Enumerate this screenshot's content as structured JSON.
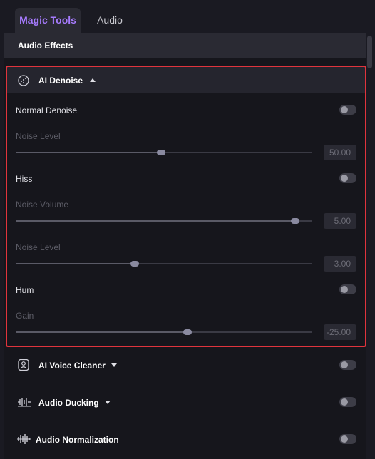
{
  "tabs": [
    {
      "label": "Magic Tools",
      "active": true
    },
    {
      "label": "Audio",
      "active": false
    }
  ],
  "section": {
    "title": "Audio Effects"
  },
  "denoise": {
    "title": "AI Denoise",
    "normal_denoise": {
      "label": "Normal Denoise",
      "enabled": false
    },
    "noise_level_1": {
      "label": "Noise Level",
      "value": "50.00",
      "fraction": 0.49
    },
    "hiss": {
      "label": "Hiss",
      "enabled": false
    },
    "noise_volume": {
      "label": "Noise Volume",
      "value": "5.00",
      "fraction": 0.942
    },
    "noise_level_2": {
      "label": "Noise Level",
      "value": "3.00",
      "fraction": 0.401
    },
    "hum": {
      "label": "Hum",
      "enabled": false
    },
    "gain": {
      "label": "Gain",
      "value": "-25.00",
      "fraction": 0.579
    }
  },
  "features": [
    {
      "label": "AI Voice Cleaner",
      "icon": "voice-cleaner-icon",
      "enabled": false
    },
    {
      "label": "Audio Ducking",
      "icon": "audio-ducking-icon",
      "enabled": false
    },
    {
      "label": "Audio Normalization",
      "icon": "audio-normalization-icon",
      "enabled": false
    }
  ],
  "colors": {
    "accent": "#a77bff",
    "highlight": "#e0343d"
  }
}
